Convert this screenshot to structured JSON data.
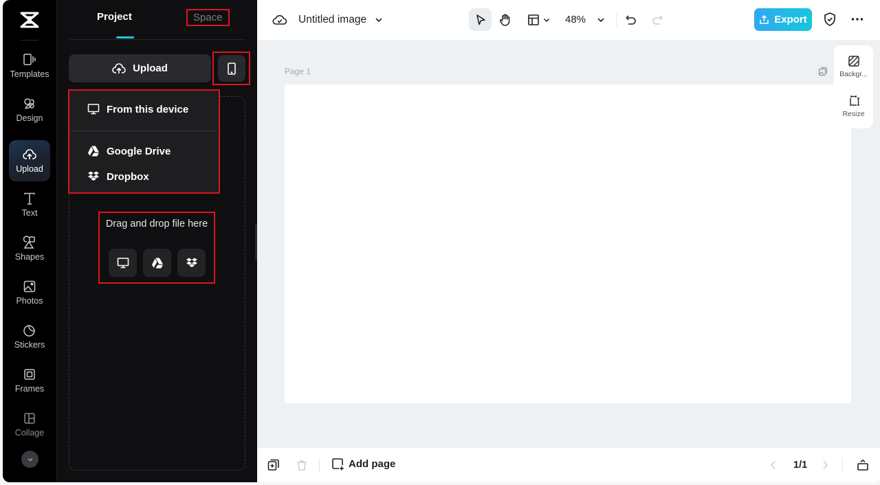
{
  "rail": {
    "items": [
      {
        "label": "Templates",
        "icon": "templates-icon"
      },
      {
        "label": "Design",
        "icon": "design-icon"
      },
      {
        "label": "Upload",
        "icon": "upload-cloud-icon",
        "active": true
      },
      {
        "label": "Text",
        "icon": "text-icon"
      },
      {
        "label": "Shapes",
        "icon": "shapes-icon"
      },
      {
        "label": "Photos",
        "icon": "photos-icon"
      },
      {
        "label": "Stickers",
        "icon": "stickers-icon"
      },
      {
        "label": "Frames",
        "icon": "frames-icon"
      },
      {
        "label": "Collage",
        "icon": "collage-icon"
      }
    ],
    "more_icon": "chevron-down-icon"
  },
  "panel": {
    "tabs": {
      "project": "Project",
      "space": "Space"
    },
    "upload_label": "Upload",
    "menu": {
      "from_device": "From this device",
      "google_drive": "Google Drive",
      "dropbox": "Dropbox"
    },
    "drag_drop_text": "Drag and drop file here"
  },
  "topbar": {
    "title": "Untitled image",
    "zoom": "48%",
    "export_label": "Export"
  },
  "canvas": {
    "page_label": "Page 1",
    "side_tools": {
      "background": "Backgr...",
      "resize": "Resize"
    }
  },
  "bottombar": {
    "add_page": "Add page",
    "pager": "1/1"
  },
  "colors": {
    "accent": "#22c4e0",
    "export_gradient_start": "#30a9f2",
    "export_gradient_end": "#17c6dc",
    "highlight_box": "#e0141e"
  }
}
